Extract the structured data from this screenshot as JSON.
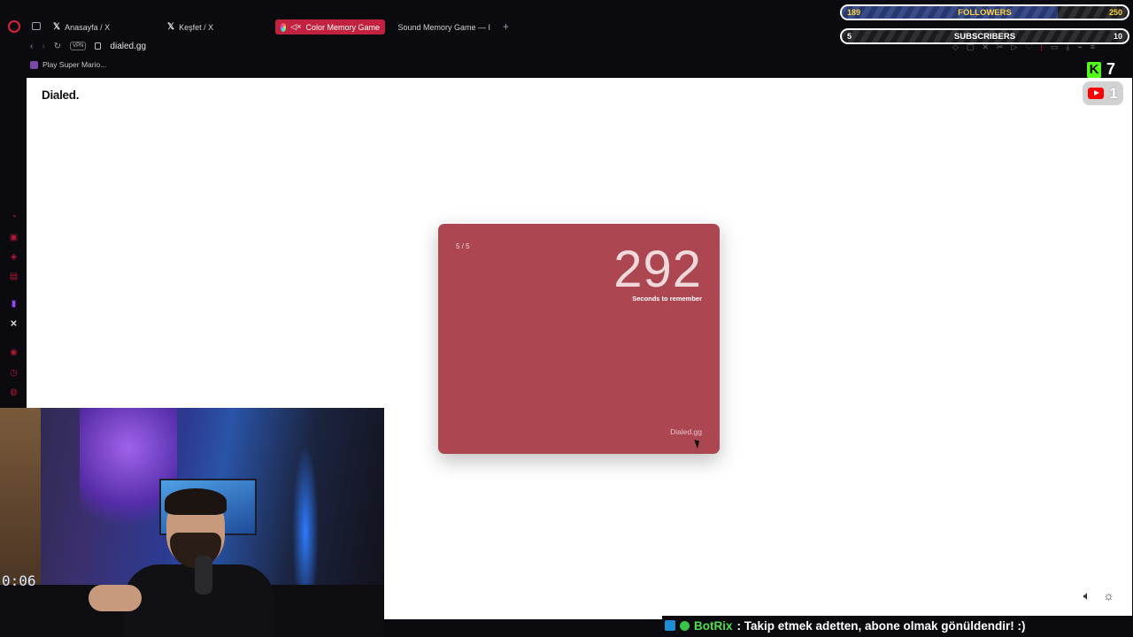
{
  "browser": {
    "tabs": [
      {
        "label": "Anasayfa / X",
        "icon": "x-icon"
      },
      {
        "label": "Keşfet / X",
        "icon": "x-icon"
      },
      {
        "label": "Color Memory Game",
        "icon": "color-wheel-icon",
        "active": true
      },
      {
        "label": "Sound Memory Game — I",
        "icon": "color-wheel-icon"
      }
    ],
    "new_tab": "+",
    "vpn_badge": "VPN",
    "url": "dialed.gg",
    "bookmark": "Play Super Mario..."
  },
  "page": {
    "brand": "Dialed.",
    "card": {
      "round": "5 / 5",
      "timer": "292",
      "timer_label": "Seconds to remember",
      "footer": "Dialed.gg",
      "color": "#ac4752"
    }
  },
  "overlay": {
    "followers": {
      "label": "FOLLOWERS",
      "current": "189",
      "goal": "250",
      "progress": 0.756
    },
    "subscribers": {
      "label": "SUBSCRIBERS",
      "current": "5",
      "goal": "10",
      "progress": 0.5
    },
    "kick_count": "7",
    "youtube_count": "1",
    "webcam_clock": "0:06"
  },
  "ticker": {
    "bot_name": "BotRix",
    "message": ": Takip etmek adetten, abone olmak gönüldendir! :)"
  },
  "colors": {
    "accent": "#c2213f",
    "kick": "#53fc18",
    "overlay_text": "#ffd23f"
  }
}
